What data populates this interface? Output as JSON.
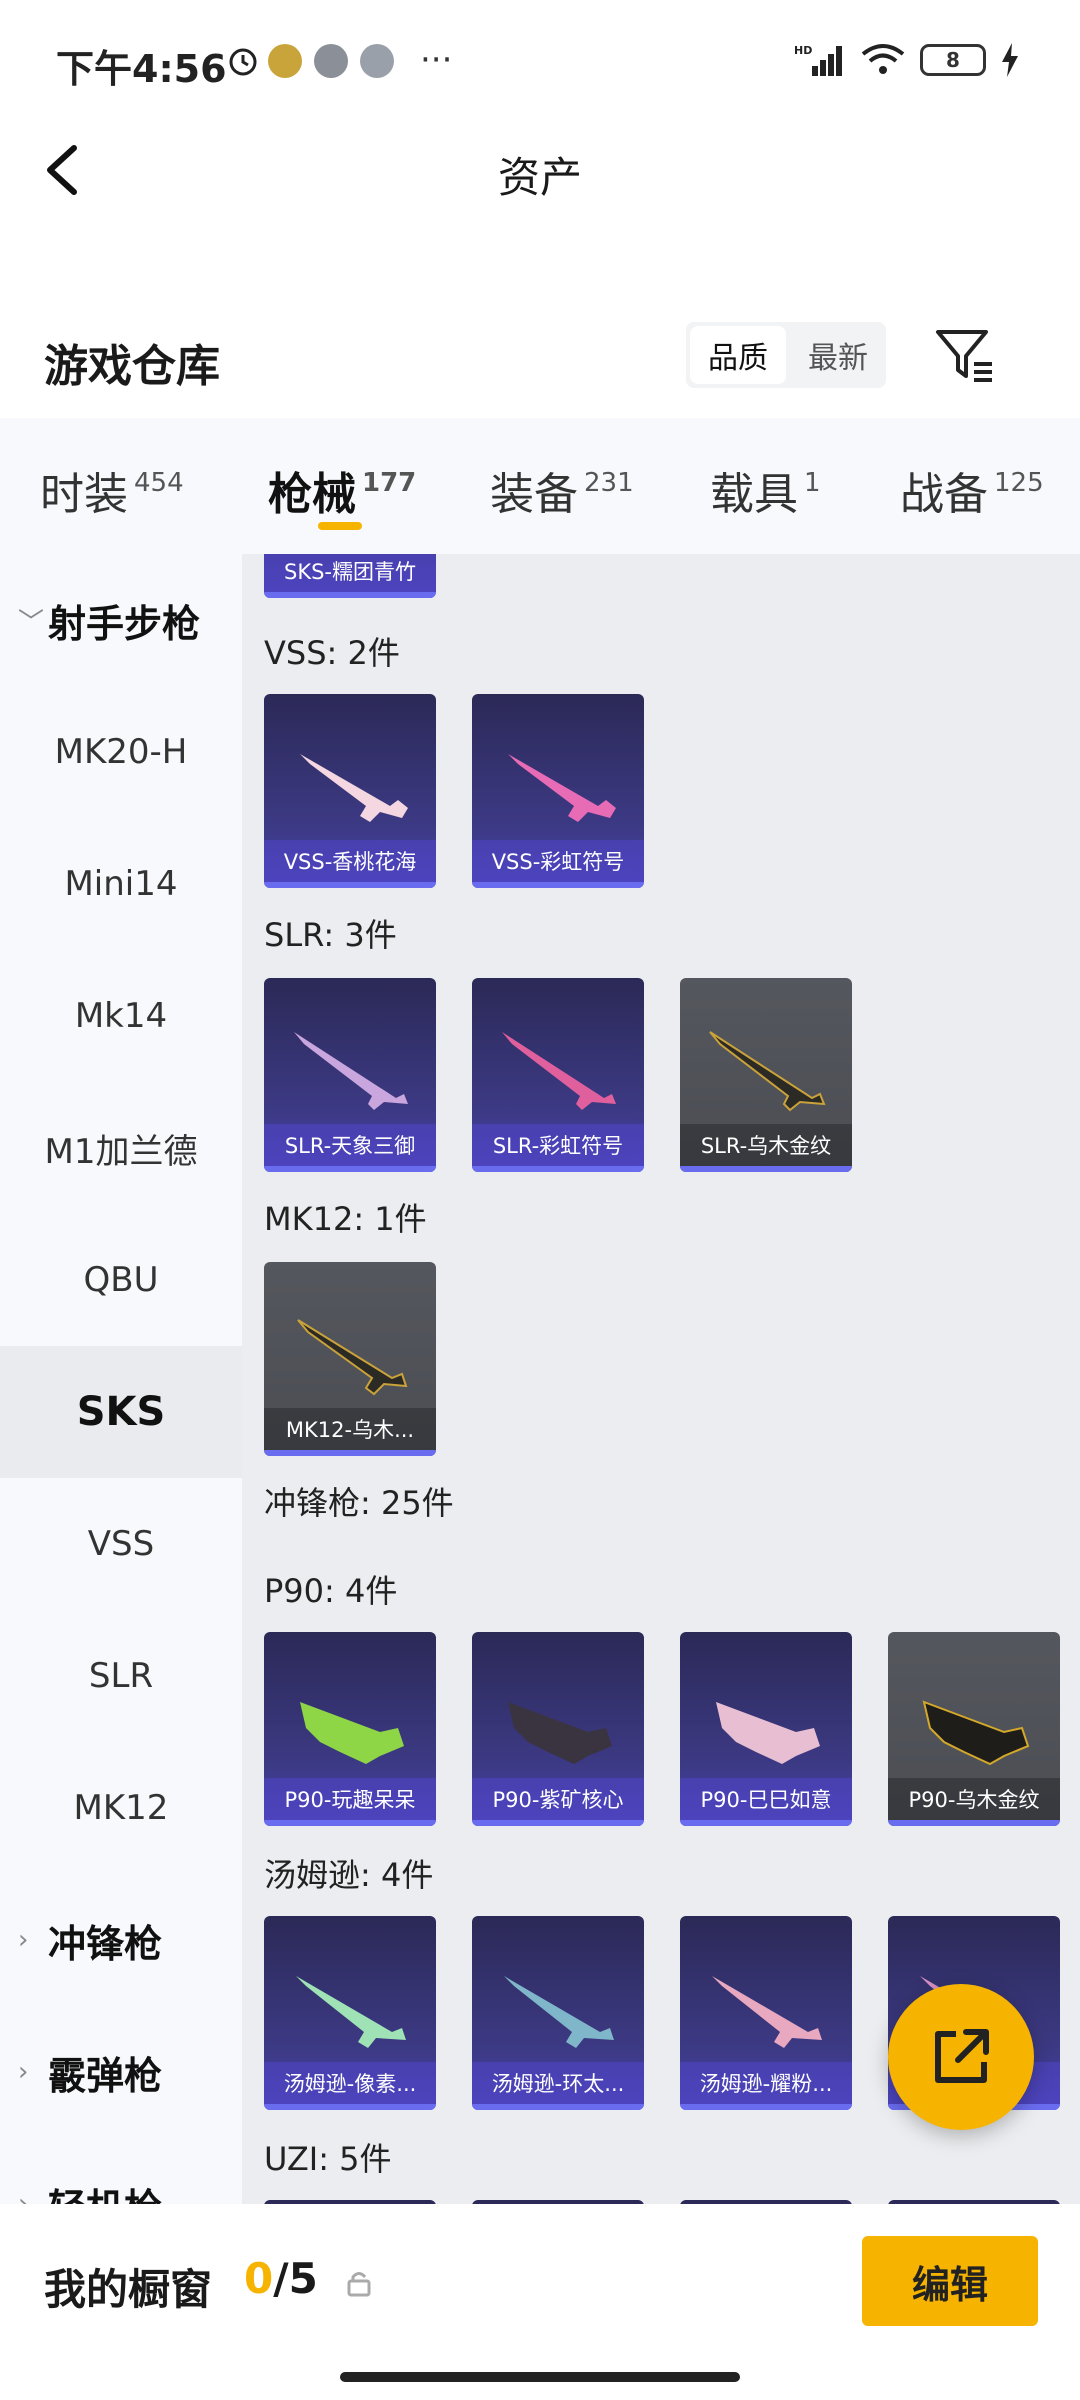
{
  "status_bar": {
    "time": "下午4:56",
    "battery": "8",
    "net_label": "HD"
  },
  "header": {
    "title": "资产"
  },
  "section": {
    "title": "游戏仓库",
    "sort_options": [
      "品质",
      "最新"
    ]
  },
  "tabs": [
    {
      "label": "时装",
      "count": "454"
    },
    {
      "label": "枪械",
      "count": "177"
    },
    {
      "label": "装备",
      "count": "231"
    },
    {
      "label": "载具",
      "count": "1"
    },
    {
      "label": "战备",
      "count": "125"
    }
  ],
  "sidebar": {
    "group_sniper": "射手步枪",
    "items": [
      "MK20-H",
      "Mini14",
      "Mk14",
      "M1加兰德",
      "QBU",
      "SKS",
      "VSS",
      "SLR",
      "MK12"
    ],
    "group_smg": "冲锋枪",
    "group_shotgun": "霰弹枪",
    "group_lmg": "轻机枪"
  },
  "content": {
    "top_card_label": "SKS-糯团青竹",
    "cat_vss": "VSS: 2件",
    "vss": [
      "VSS-香桃花海",
      "VSS-彩虹符号"
    ],
    "cat_slr": "SLR: 3件",
    "slr": [
      "SLR-天象三御",
      "SLR-彩虹符号",
      "SLR-乌木金纹"
    ],
    "cat_mk12": "MK12: 1件",
    "mk12": [
      "MK12-乌木..."
    ],
    "cat_smg": "冲锋枪: 25件",
    "cat_p90": "P90: 4件",
    "p90": [
      "P90-玩趣呆呆",
      "P90-紫矿核心",
      "P90-巳巳如意",
      "P90-乌木金纹"
    ],
    "cat_thompson": "汤姆逊: 4件",
    "thompson": [
      "汤姆逊-像素...",
      "汤姆逊-环太...",
      "汤姆逊-耀粉...",
      ""
    ],
    "cat_uzi": "UZI: 5件"
  },
  "bottom_bar": {
    "label": "我的橱窗",
    "current": "0",
    "total": "/5",
    "edit": "编辑"
  },
  "colors": {
    "accent": "#f6b400",
    "card_purple": "#3d3a86",
    "card_gray": "#55575e"
  }
}
